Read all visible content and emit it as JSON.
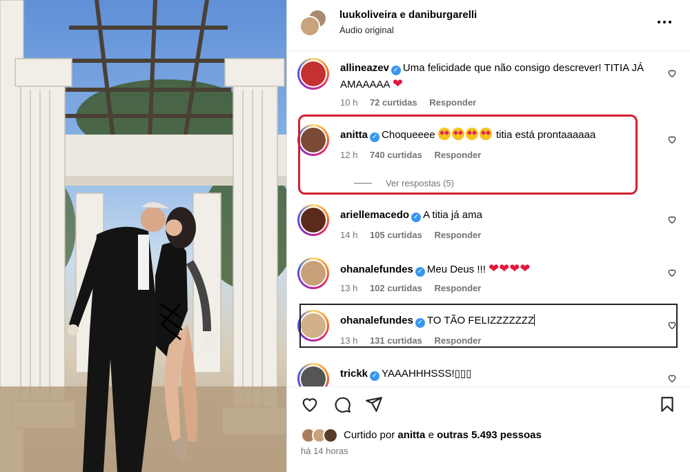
{
  "post": {
    "authors": "luukoliveira e daniburgarelli",
    "audio": "Áudio original",
    "more_icon": "more-horizontal-icon"
  },
  "comments": [
    {
      "user": "allineazev",
      "text": "Uma felicidade que não consigo descrever! TITIA JÁ AMAAAAA",
      "time": "10 h",
      "likes": "72 curtidas",
      "reply": "Responder",
      "avatar_color": "#c53030"
    },
    {
      "user": "anitta",
      "text_a": "Choqueeee",
      "text_b": "titia está prontaaaaaa",
      "time": "12 h",
      "likes": "740 curtidas",
      "reply": "Responder",
      "view_replies": "Ver respostas (5)",
      "avatar_color": "#7a4a35"
    },
    {
      "user": "ariellemacedo",
      "text": "A titia já ama",
      "time": "14 h",
      "likes": "105 curtidas",
      "reply": "Responder",
      "avatar_color": "#5a2a1a"
    },
    {
      "user": "ohanalefundes",
      "text": "Meu Deus !!!",
      "time": "13 h",
      "likes": "102 curtidas",
      "reply": "Responder",
      "avatar_color": "#c8a07a"
    },
    {
      "user": "ohanalefundes",
      "text": "TO TÃO FELIZZZZZZZ",
      "time": "13 h",
      "likes": "131 curtidas",
      "reply": "Responder",
      "avatar_color": "#d2b08a"
    },
    {
      "user": "trickk",
      "text": "YAAAHHHSSS!▯▯▯",
      "avatar_color": "#555555"
    }
  ],
  "actions": {
    "like_icon": "heart-icon",
    "comment_icon": "comment-icon",
    "share_icon": "send-icon",
    "save_icon": "bookmark-icon"
  },
  "likes_line": {
    "prefix": "Curtido por",
    "first": "anitta",
    "conj": "e",
    "rest": "outras 5.493 pessoas"
  },
  "time_ago": "há 14 horas",
  "colors": {
    "highlight_red": "#d21f2e",
    "verified_blue": "#3897f0",
    "meta_gray": "#737373",
    "heart_red": "#e3173e"
  }
}
